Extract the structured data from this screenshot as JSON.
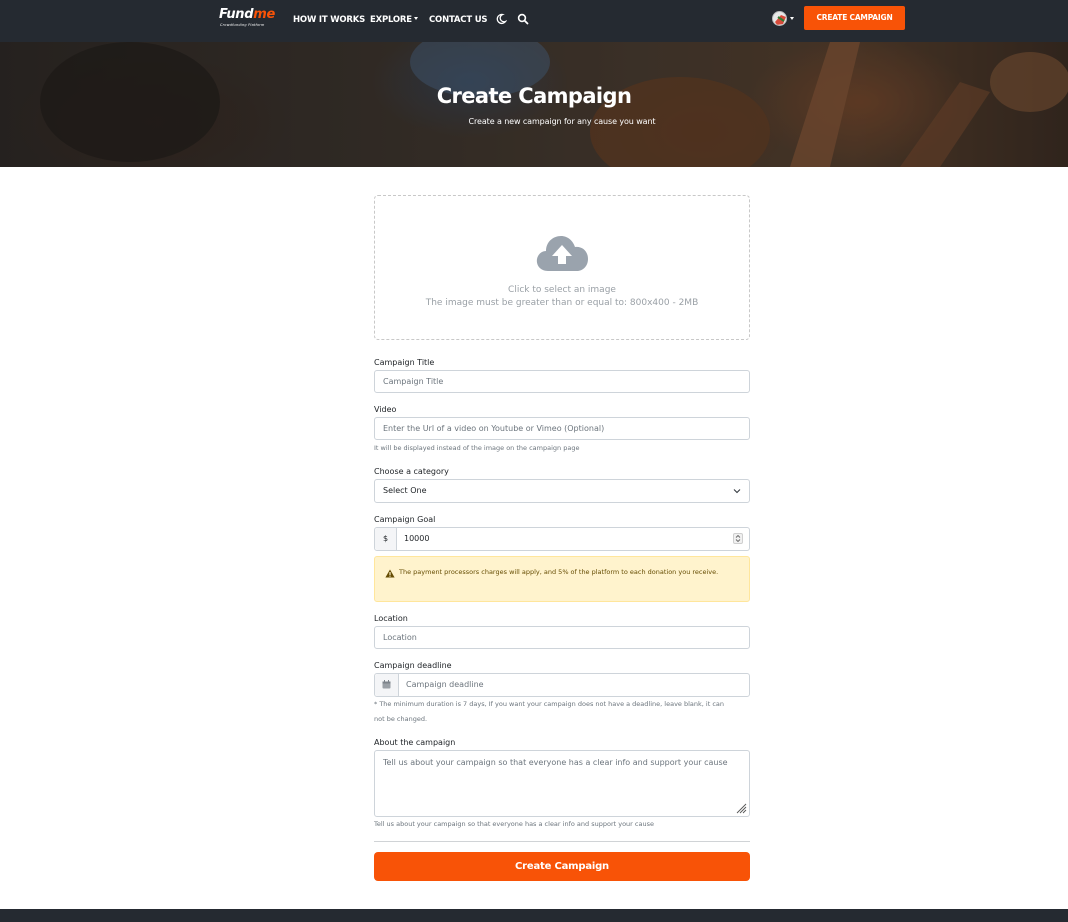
{
  "navbar": {
    "logo": {
      "brand_prefix": "Fund",
      "brand_suffix": "me",
      "tagline": "Crowdfunding Platform"
    },
    "links": {
      "how_it_works": "HOW IT WORKS",
      "explore": "EXPLORE",
      "contact_us": "CONTACT US"
    },
    "cta": "CREATE CAMPAIGN",
    "icons": [
      "moon-icon",
      "search-icon",
      "globe-icon"
    ]
  },
  "hero": {
    "title": "Create Campaign",
    "subtitle": "Create a new campaign for any cause you want"
  },
  "form": {
    "upload": {
      "line1": "Click to select an image",
      "line2": "The image must be greater than or equal to: 800x400 - 2MB",
      "icon": "cloud-upload-icon"
    },
    "title_field": {
      "label": "Campaign Title",
      "placeholder": "Campaign Title"
    },
    "video_field": {
      "label": "Video",
      "placeholder": "Enter the Url of a video on Youtube or Vimeo (Optional)",
      "help": "It will be displayed instead of the image on the campaign page"
    },
    "category_field": {
      "label": "Choose a category",
      "selected": "Select One"
    },
    "goal_field": {
      "label": "Campaign Goal",
      "currency": "$",
      "value": "10000"
    },
    "alert": {
      "text": "The payment processors charges will apply, and 5% of the platform to each donation you receive."
    },
    "location_field": {
      "label": "Location",
      "placeholder": "Location"
    },
    "deadline_field": {
      "label": "Campaign deadline",
      "placeholder": "Campaign deadline",
      "help_line1": "* The minimum duration is 7 days, If you want your campaign does not have a deadline, leave blank, it can",
      "help_line2": "not be changed."
    },
    "about_field": {
      "label": "About the campaign",
      "placeholder": "Tell us about your campaign so that everyone has a clear info and support your cause",
      "help": "Tell us about your campaign so that everyone has a clear info and support your cause"
    },
    "submit": "Create Campaign"
  },
  "colors": {
    "brand": "#f85307",
    "navbar_bg": "#252a31",
    "alert_bg": "#fff3cd",
    "alert_text": "#664d03"
  }
}
